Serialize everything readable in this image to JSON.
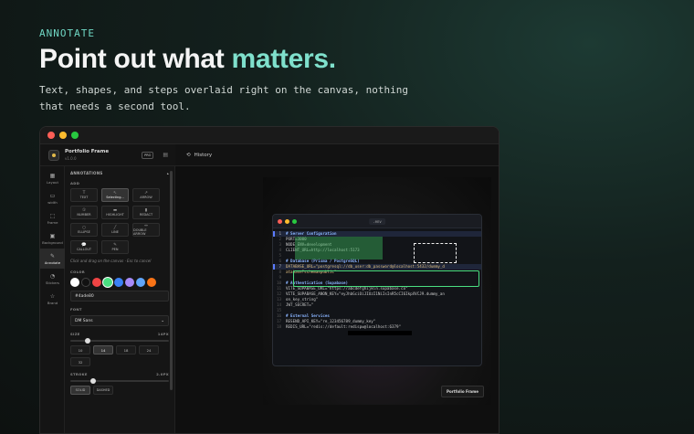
{
  "hero": {
    "eyebrow": "ANNOTATE",
    "headline_main": "Point out what ",
    "headline_accent": "matters.",
    "subline": "Text, shapes, and steps overlaid right on the canvas, nothing that needs a second tool."
  },
  "window": {
    "traffic_lights": [
      "#ff5f57",
      "#febc2e",
      "#28c840"
    ]
  },
  "app": {
    "name": "Portfolio Frame",
    "version": "v1.0.0",
    "pro_badge": "PRO"
  },
  "nav": {
    "items": [
      {
        "label": "Layout",
        "icon": "▦"
      },
      {
        "label": "width",
        "icon": "▭"
      },
      {
        "label": "Frame",
        "icon": "⬚"
      },
      {
        "label": "Background",
        "icon": "▣"
      },
      {
        "label": "Annotate",
        "icon": "✎"
      },
      {
        "label": "Stickers",
        "icon": "◔"
      },
      {
        "label": "Brand",
        "icon": "☆"
      }
    ]
  },
  "annotations": {
    "section_title": "ANNOTATIONS",
    "add_label": "ADD",
    "tools": [
      {
        "label": "TEXT",
        "icon": "T"
      },
      {
        "label": "Selecting...",
        "icon": "↖"
      },
      {
        "label": "ARROW",
        "icon": "↗"
      },
      {
        "label": "NUMBER",
        "icon": "①"
      },
      {
        "label": "HIGHLIGHT",
        "icon": "▬"
      },
      {
        "label": "REDACT",
        "icon": "▮"
      },
      {
        "label": "ELLIPSE",
        "icon": "○"
      },
      {
        "label": "LINE",
        "icon": "╱"
      },
      {
        "label": "DOUBLE ARROW",
        "icon": "↔"
      },
      {
        "label": "CALLOUT",
        "icon": "💬"
      },
      {
        "label": "PEN",
        "icon": "✎"
      }
    ],
    "hint": "Click and drag on the canvas · Esc to cancel",
    "color_label": "COLOR",
    "colors": [
      "#ffffff",
      "#111111",
      "#ef4444",
      "#4ade80",
      "#3b82f6",
      "#a78bfa",
      "#60a5fa",
      "#f97316"
    ],
    "color_value": "#4ade80",
    "font_label": "FONT",
    "font_value": "DM Sans",
    "size_label": "SIZE",
    "size_value": "14PX",
    "size_fraction": 0.15,
    "sizes": [
      "10",
      "14",
      "18",
      "24",
      "32"
    ],
    "stroke_label": "STROKE",
    "stroke_value": "2.0PX",
    "stroke_fraction": 0.2,
    "stroke_styles": [
      "SOLID",
      "DASHED"
    ]
  },
  "topbar": {
    "history_label": "History"
  },
  "canvas": {
    "badge": "Portfolio Frame",
    "editor": {
      "tab": ".env",
      "lines": [
        {
          "n": "1",
          "t": "# Server Configuration",
          "cls": "c-head",
          "hl": true
        },
        {
          "n": "2",
          "t": "PORT=3000",
          "cls": "c-key"
        },
        {
          "n": "3",
          "t": "NODE_ENV=development",
          "cls": "c-key"
        },
        {
          "n": "4",
          "t": "CLIENT_URL=http://localhost:5173",
          "cls": "c-key"
        },
        {
          "n": "5",
          "t": "",
          "cls": "c-key"
        },
        {
          "n": "6",
          "t": "# Database (Prisma / PostgreSQL)",
          "cls": "c-head"
        },
        {
          "n": "7",
          "t": "DATABASE_URL=\"postgresql://db_user:db_password@localhost:5432/dummy_d",
          "cls": "c-str",
          "hl": true
        },
        {
          "n": "8",
          "t": "atabase?schema=public\"",
          "cls": "c-str"
        },
        {
          "n": "9",
          "t": "",
          "cls": "c-key"
        },
        {
          "n": "10",
          "t": "# Authentication (Supabase)",
          "cls": "c-head"
        },
        {
          "n": "11",
          "t": "VITE_SUPABASE_URL=\"https://abcdefghijkln.supabase.co\"",
          "cls": "c-key"
        },
        {
          "n": "12",
          "t": "VITE_SUPABASE_ANON_KEY=\"eyJhbGciOiJIUzI1NiIsInR5cCI6IkpXVCJ9.dummy_an",
          "cls": "c-key"
        },
        {
          "n": "13",
          "t": "on_key_string\"",
          "cls": "c-key"
        },
        {
          "n": "14",
          "t": "JWT_SECRET=\"",
          "cls": "c-key"
        },
        {
          "n": "15",
          "t": "",
          "cls": "c-key"
        },
        {
          "n": "16",
          "t": "# External Services",
          "cls": "c-head"
        },
        {
          "n": "17",
          "t": "RESEND_API_KEY=\"re_123456789_dummy_key\"",
          "cls": "c-key"
        },
        {
          "n": "18",
          "t": "REDIS_URL=\"redis://default:redispw@localhost:6379\"",
          "cls": "c-key"
        }
      ]
    }
  }
}
